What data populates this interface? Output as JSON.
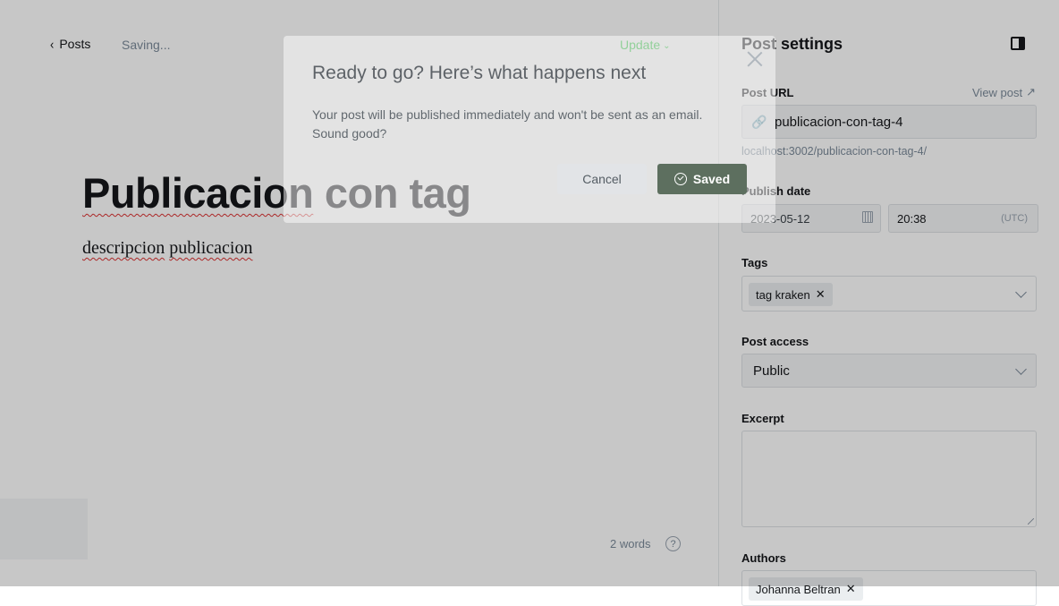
{
  "editor": {
    "back_label": "Posts",
    "status": "Saving...",
    "update_label": "Update",
    "title_part1": "Publicacion",
    "title_part2": " con tag",
    "body_word1": "descripcion",
    "body_word2": "publicacion",
    "word_count": "2 words",
    "help_glyph": "?"
  },
  "settings": {
    "title": "Post settings",
    "post_url_label": "Post URL",
    "view_post_label": "View post",
    "post_url_value": "publicacion-con-tag-4",
    "url_hint": "localhost:3002/publicacion-con-tag-4/",
    "publish_date_label": "Publish date",
    "date_value": "2023-05-12",
    "time_value": "20:38",
    "timezone": "(UTC)",
    "tags_label": "Tags",
    "tag": "tag kraken",
    "access_label": "Post access",
    "access_value": "Public",
    "excerpt_label": "Excerpt",
    "authors_label": "Authors",
    "author": "Johanna Beltran"
  },
  "modal": {
    "title": "Ready to go? Here’s what happens next",
    "text": "Your post will be published immediately and won't be sent as an email. Sound good?",
    "cancel_label": "Cancel",
    "saved_label": "Saved"
  },
  "colors": {
    "accent_green": "#30cf43",
    "saved_button": "#5d6f5f",
    "overlay": "rgba(0,0,0,0.22)"
  }
}
